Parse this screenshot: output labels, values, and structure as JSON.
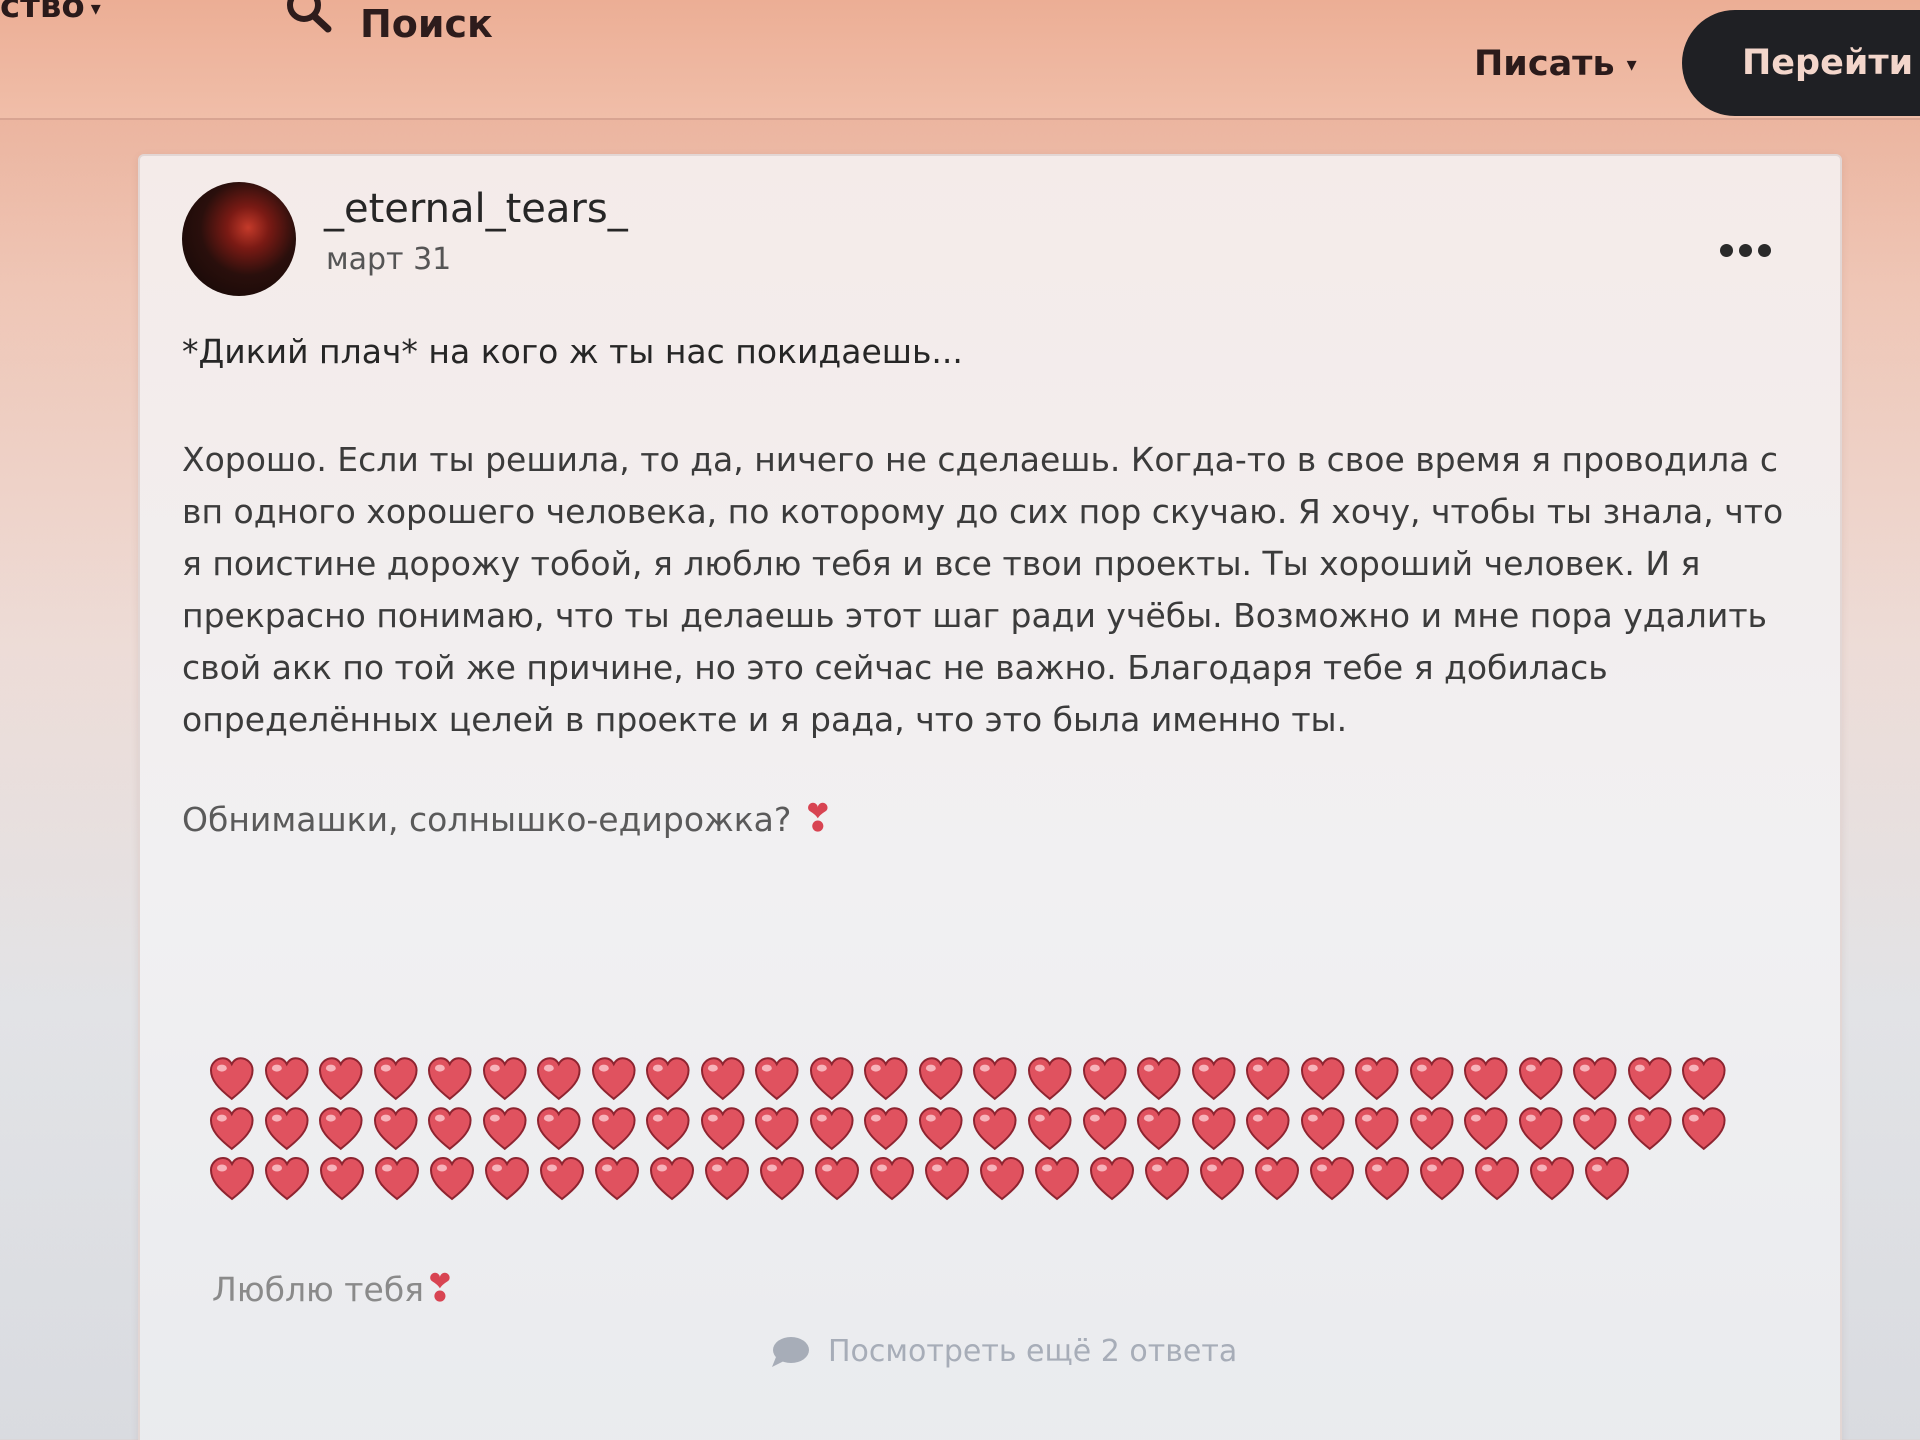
{
  "nav": {
    "left_item": "ство",
    "search_label": "Поиск",
    "write_label": "Писать",
    "goto_label": "Перейти н"
  },
  "post": {
    "username": "_eternal_tears_",
    "date": "март 31",
    "lines": [
      "*Дикий плач* на кого ж ты нас покидаешь...",
      "Хорошо. Если ты решила, то да, ничего не сделаешь. Когда-то в свое время я проводила с",
      "вп одного хорошего человека, по которому до сих пор скучаю. Я хочу, чтобы ты знала, что",
      "я поистине дорожу тобой, я люблю тебя и все твои проекты. Ты хороший человек. И я",
      "прекрасно понимаю, что ты делаешь этот шаг ради учёбы. Возможно и мне пора удалить",
      "свой акк по той же причине, но это сейчас не важно. Благодаря тебе я добилась",
      "определённых целей в проекте и я рада, что это была именно ты."
    ],
    "hug_line": "Обнимашки, солнышко-едирожка?",
    "heart_rows": [
      28,
      28,
      26
    ],
    "love_line": "Люблю тебя",
    "heart_color": "#e0525f"
  },
  "replies": {
    "label": "Посмотреть ещё 2 ответа"
  }
}
